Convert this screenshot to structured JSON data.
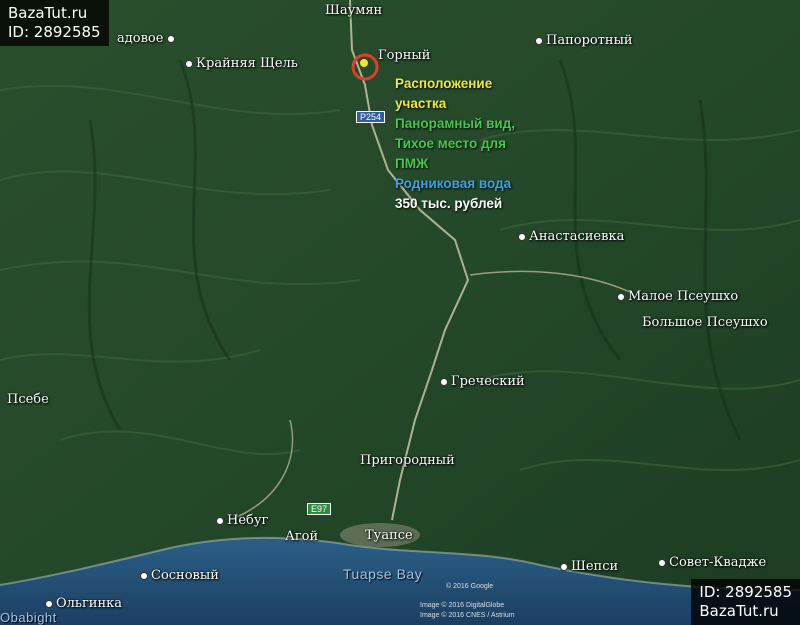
{
  "watermark_top": {
    "site": "BazaTut.ru",
    "id": "ID: 2892585"
  },
  "watermark_bottom": {
    "id": "ID: 2892585",
    "site": "BazaTut.ru"
  },
  "places": {
    "shaumyan": "Шаумян",
    "sadovoe": "адовое",
    "krainyaya_shchel": "Крайняя Щель",
    "gorny": "Горный",
    "paporotny": "Папоротный",
    "anastasievka": "Анастасиевка",
    "maloe_pseushkho": "Малое Псеушхо",
    "bolshoe_pseushkho": "Большое Псеушхо",
    "psebe": "Псебе",
    "grechesky": "Греческий",
    "prigorodny": "Пригородный",
    "nebug": "Небуг",
    "agoy": "Агой",
    "tuapse": "Туапсе",
    "sovet_kvadzhe": "Совет-Квадже",
    "shepsi": "Шепси",
    "sosnovy": "Сосновый",
    "olginka": "Ольгинка"
  },
  "water_labels": {
    "bay": "Tuapse Bay",
    "sea_partial": "Obabight"
  },
  "roads": {
    "r254": "P254",
    "e97": "E97"
  },
  "annotation": {
    "line1": "Расположение",
    "line2": "участка",
    "line3": "Панорамный вид,",
    "line4": "Тихое место для",
    "line5": "ПМЖ",
    "line6": "Родниковая вода",
    "line7": "350 тыс. рублей"
  },
  "annotation_colors": {
    "yellow": "#f2e83a",
    "green": "#3ecb4a",
    "blue": "#3aa3e0",
    "white": "#ffffff"
  },
  "credits": {
    "google": "© 2016 Google",
    "digitalglobe": "Image © 2016 DigitalGlobe",
    "cnes": "Image © 2016 CNES / Astrium"
  }
}
